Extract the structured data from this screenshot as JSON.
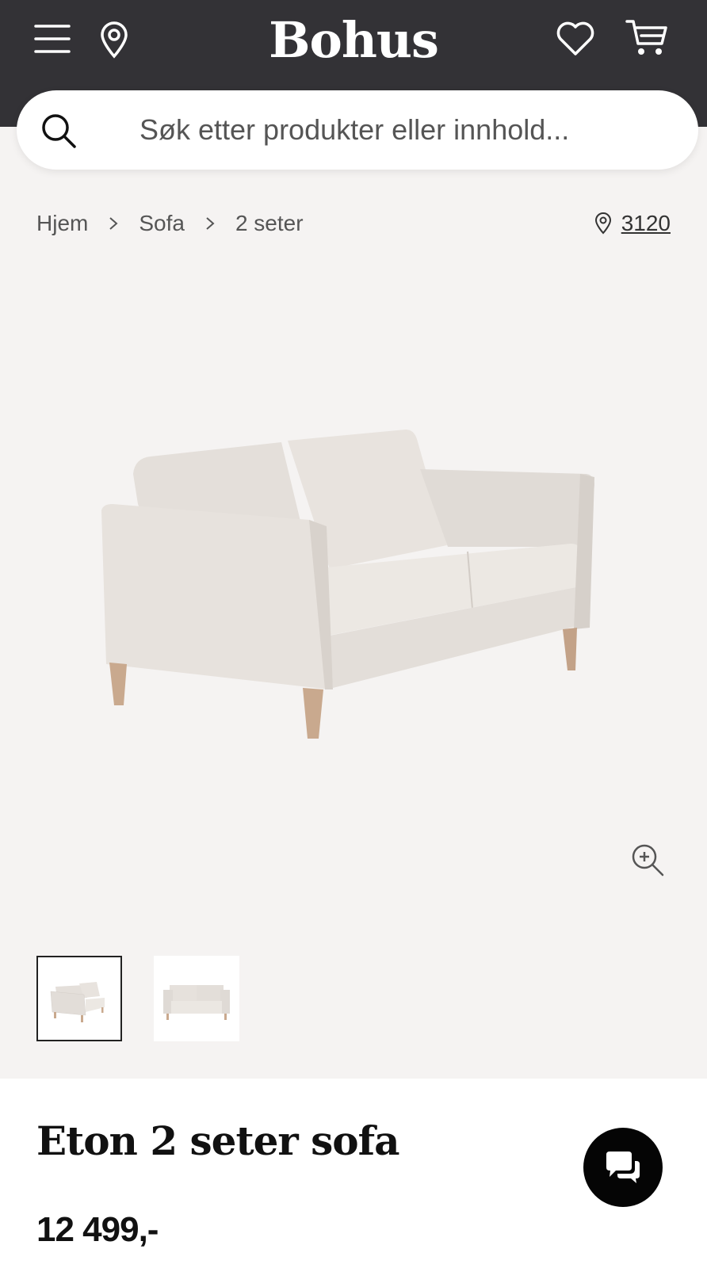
{
  "header": {
    "logo": "Bohus",
    "icons": [
      "menu-icon",
      "location-pin-icon",
      "heart-icon",
      "cart-icon"
    ],
    "background": "#333236"
  },
  "search": {
    "placeholder": "Søk etter produkter eller innhold..."
  },
  "breadcrumb": {
    "items": [
      "Hjem",
      "Sofa",
      "2 seter"
    ],
    "store_code": "3120"
  },
  "gallery": {
    "thumbnail_count": 2,
    "active_thumbnail": 1
  },
  "product": {
    "title": "Eton 2 seter sofa",
    "price": "12 499,-"
  },
  "colors": {
    "gallery_bg": "#f5f3f2",
    "sofa_fabric": "#e6e1dc",
    "sofa_legs": "#c9a98e"
  }
}
